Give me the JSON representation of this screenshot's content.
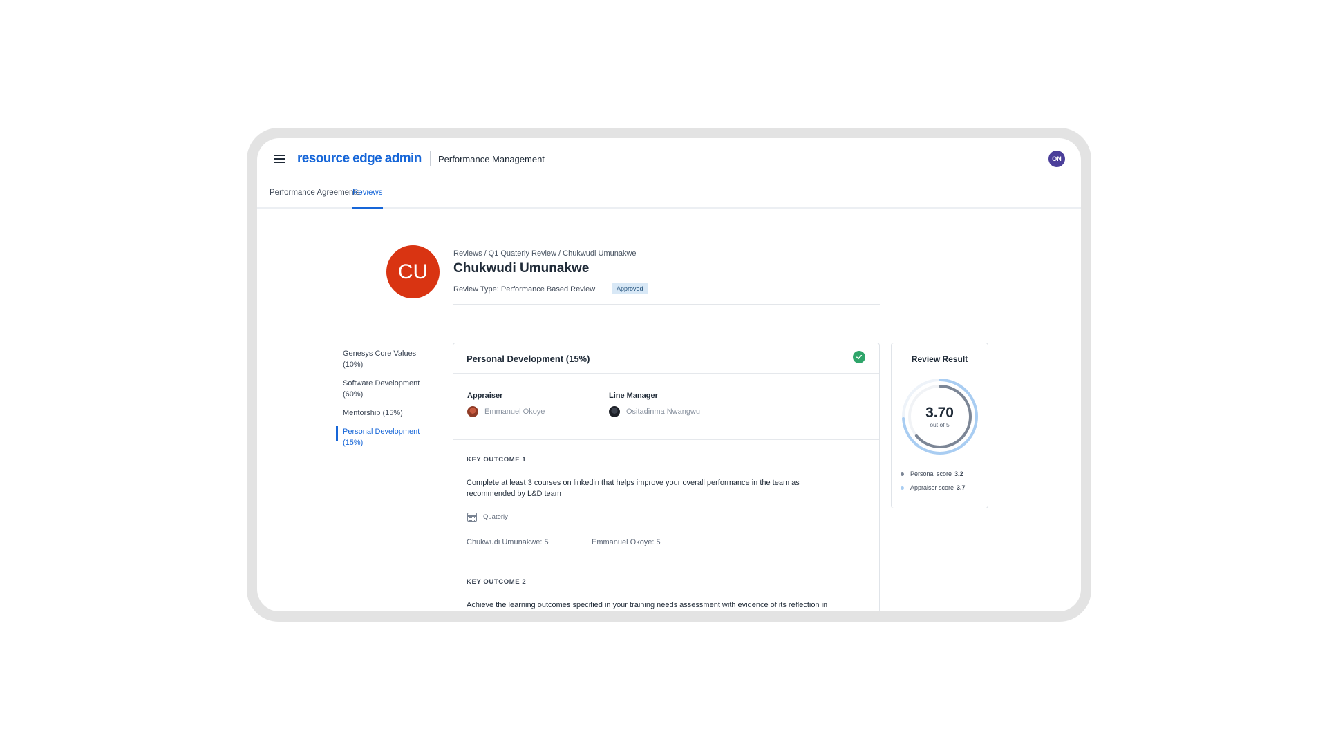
{
  "header": {
    "logo": "resource edge admin",
    "app_title": "Performance Management",
    "user_initials": "ON"
  },
  "tabs": [
    {
      "label": "Performance Agreements",
      "active": false
    },
    {
      "label": "Reviews",
      "active": true
    }
  ],
  "profile": {
    "initials": "CU",
    "breadcrumb": [
      "Reviews",
      "Q1 Quaterly Review",
      "Chukwudi Umunakwe"
    ],
    "name": "Chukwudi Umunakwe",
    "review_type": "Review Type: Performance Based Review",
    "status": "Approved"
  },
  "sections": [
    {
      "label": "Genesys Core Values (10%)",
      "active": false
    },
    {
      "label": "Software Development (60%)",
      "active": false
    },
    {
      "label": "Mentorship (15%)",
      "active": false
    },
    {
      "label": "Personal Development (15%)",
      "active": true
    }
  ],
  "card": {
    "title": "Personal Development (15%)",
    "appraiser_label": "Appraiser",
    "appraiser_name": "Emmanuel Okoye",
    "manager_label": "Line Manager",
    "manager_name": "Ositadinma Nwangwu",
    "outcomes": [
      {
        "label": "KEY OUTCOME 1",
        "text": "Complete at least 3 courses on linkedin that helps improve your overall performance in the team as recommended by L&D team",
        "frequency": "Quaterly",
        "self_score": "Chukwudi Umunakwe: 5",
        "appraiser_score": "Emmanuel Okoye: 5"
      },
      {
        "label": "KEY OUTCOME 2",
        "text": "Achieve the learning outcomes specified in your training needs assessment with evidence of its reflection in your routine work"
      }
    ]
  },
  "result": {
    "title": "Review Result",
    "value": "3.70",
    "max_text": "out of 5",
    "score_max": 5,
    "personal_label": "Personal score",
    "personal_score": 3.2,
    "appraiser_label": "Appraiser score",
    "appraiser_score": 3.7,
    "colors": {
      "personal": "#7c8696",
      "appraiser": "#a9cdf2",
      "accent": "#1666d8"
    }
  }
}
